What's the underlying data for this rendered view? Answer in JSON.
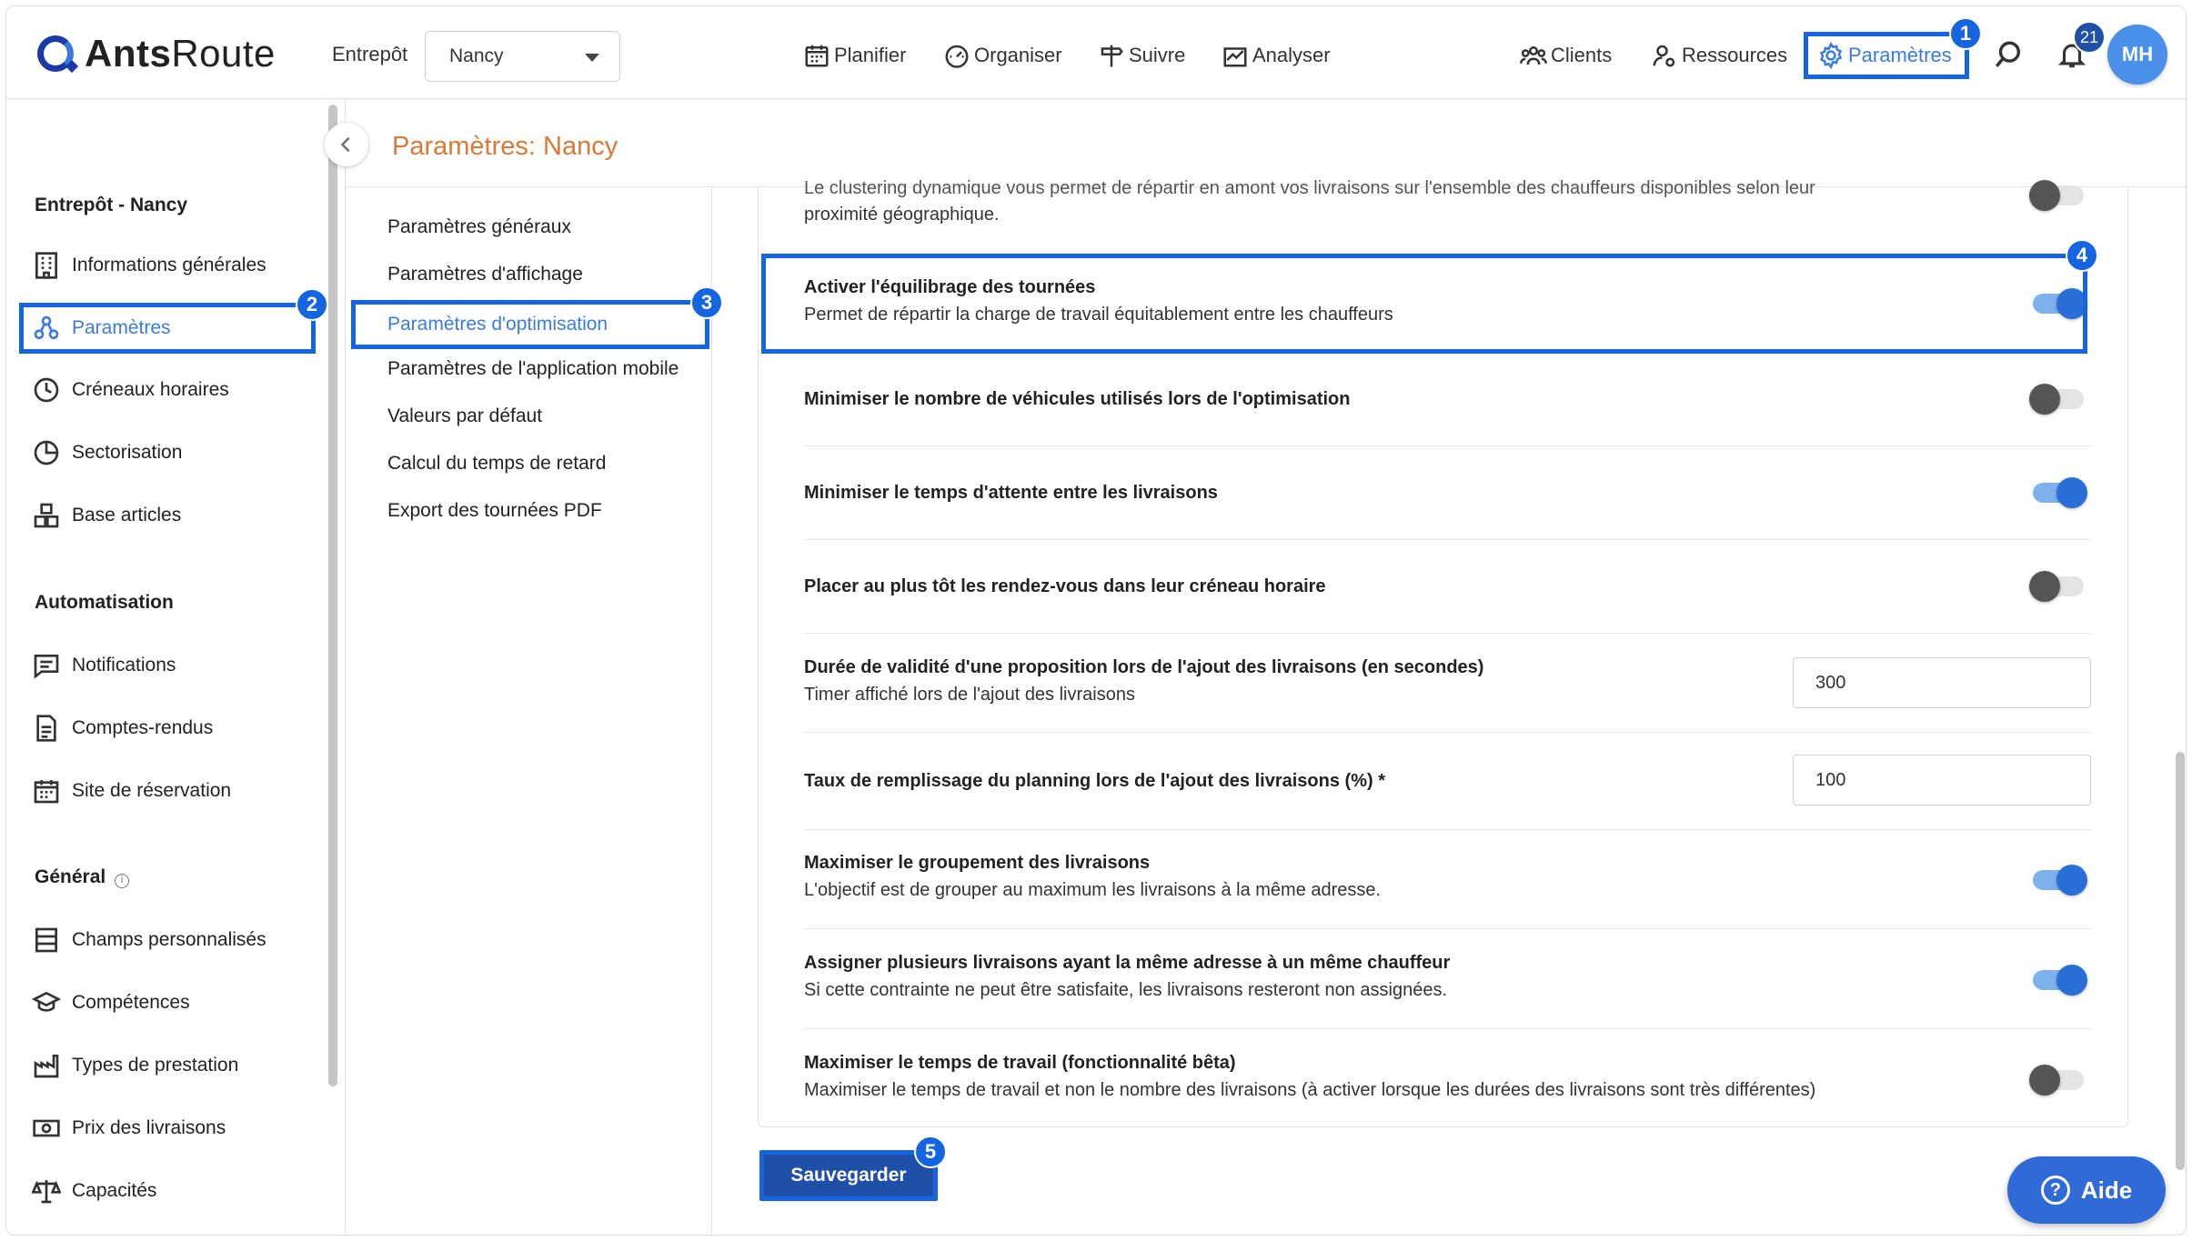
{
  "brand": {
    "logo_text_bold": "Ants",
    "logo_text_regular": "Route"
  },
  "header": {
    "warehouse_label": "Entrepôt",
    "warehouse_value": "Nancy",
    "nav": {
      "planifier": "Planifier",
      "organiser": "Organiser",
      "suivre": "Suivre",
      "analyser": "Analyser",
      "clients": "Clients",
      "ressources": "Ressources",
      "parametres": "Paramètres"
    },
    "notifications_count": "21",
    "avatar_initials": "MH"
  },
  "steps": {
    "s1": "1",
    "s2": "2",
    "s3": "3",
    "s4": "4",
    "s5": "5"
  },
  "sidebar": {
    "section1": "Entrepôt - Nancy",
    "items1": [
      "Informations générales",
      "Paramètres",
      "Créneaux horaires",
      "Sectorisation",
      "Base articles"
    ],
    "section2": "Automatisation",
    "items2": [
      "Notifications",
      "Comptes-rendus",
      "Site de réservation"
    ],
    "section3": "Général",
    "items3": [
      "Champs personnalisés",
      "Compétences",
      "Types de prestation",
      "Prix des livraisons",
      "Capacités"
    ]
  },
  "page_title": "Paramètres: Nancy",
  "submenu": [
    "Paramètres généraux",
    "Paramètres d'affichage",
    "Paramètres d'optimisation",
    "Paramètres de l'application mobile",
    "Valeurs par défaut",
    "Calcul du temps de retard",
    "Export des tournées PDF"
  ],
  "settings": {
    "partial_desc_line1": "Le clustering dynamique vous permet de répartir en amont vos livraisons sur l'ensemble des chauffeurs disponibles selon leur",
    "partial_desc_line2": "proximité géographique.",
    "rows": [
      {
        "title": "Activer l'équilibrage des tournées",
        "desc": "Permet de répartir la charge de travail équitablement entre les chauffeurs",
        "toggle": "on"
      },
      {
        "title": "Minimiser le nombre de véhicules utilisés lors de l'optimisation",
        "desc": "",
        "toggle": "off"
      },
      {
        "title": "Minimiser le temps d'attente entre les livraisons",
        "desc": "",
        "toggle": "on"
      },
      {
        "title": "Placer au plus tôt les rendez-vous dans leur créneau horaire",
        "desc": "",
        "toggle": "off"
      },
      {
        "title": "Durée de validité d'une proposition lors de l'ajout des livraisons (en secondes)",
        "desc": "Timer affiché lors de l'ajout des livraisons",
        "input": "300"
      },
      {
        "title": "Taux de remplissage du planning lors de l'ajout des livraisons (%) *",
        "desc": "",
        "input": "100"
      },
      {
        "title": "Maximiser le groupement des livraisons",
        "desc": "L'objectif est de grouper au maximum les livraisons à la même adresse.",
        "toggle": "on"
      },
      {
        "title": "Assigner plusieurs livraisons ayant la même adresse à un même chauffeur",
        "desc": "Si cette contrainte ne peut être satisfaite, les livraisons resteront non assignées.",
        "toggle": "on"
      },
      {
        "title": "Maximiser le temps de travail (fonctionnalité bêta)",
        "desc": "Maximiser le temps de travail et non le nombre des livraisons (à activer lorsque les durées des livraisons sont très différentes)",
        "toggle": "off"
      }
    ]
  },
  "save_label": "Sauvegarder",
  "help_label": "Aide",
  "colors": {
    "accent": "#1565e0",
    "title": "#d77a37",
    "primary_button": "#1f4fa6"
  }
}
